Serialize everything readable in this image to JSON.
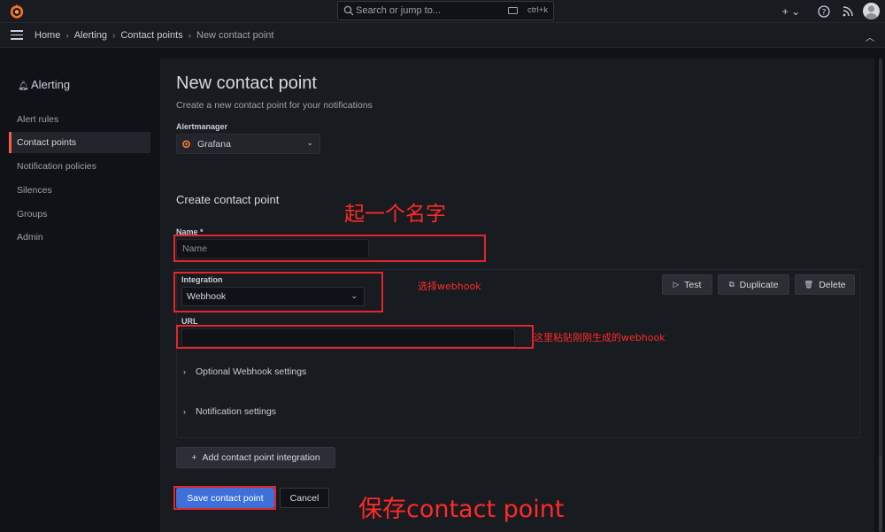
{
  "topbar": {
    "search_placeholder": "Search or jump to...",
    "search_shortcut": "ctrl+k",
    "plus_label": "+ ⌄",
    "help_icon": "help-icon",
    "news_icon": "rss-icon"
  },
  "breadcrumb": {
    "items": [
      "Home",
      "Alerting",
      "Contact points",
      "New contact point"
    ]
  },
  "sidebar": {
    "title": "Alerting",
    "items": [
      "Alert rules",
      "Contact points",
      "Notification policies",
      "Silences",
      "Groups",
      "Admin"
    ],
    "active": "Contact points"
  },
  "page": {
    "title": "New contact point",
    "subtitle": "Create a new contact point for your notifications",
    "alertmanager_label": "Alertmanager",
    "alertmanager_value": "Grafana",
    "section_title": "Create contact point",
    "name_label": "Name *",
    "name_placeholder": "Name",
    "integration_label": "Integration",
    "integration_value": "Webhook",
    "url_label": "URL",
    "url_value": "",
    "test_label": "Test",
    "duplicate_label": "Duplicate",
    "delete_label": "Delete",
    "optional_settings": "Optional Webhook settings",
    "notification_settings": "Notification settings",
    "add_integration": "Add contact point integration",
    "save_label": "Save contact point",
    "cancel_label": "Cancel"
  },
  "annotations": {
    "name_note": "起一个名字",
    "integration_note": "选择webhook",
    "url_note": "这里粘贴刚刚生成的webhook",
    "save_note": "保存contact point"
  },
  "colors": {
    "accent": "#f55f3e",
    "primary_button": "#3d71d9",
    "annotation": "#ff2a2a"
  }
}
